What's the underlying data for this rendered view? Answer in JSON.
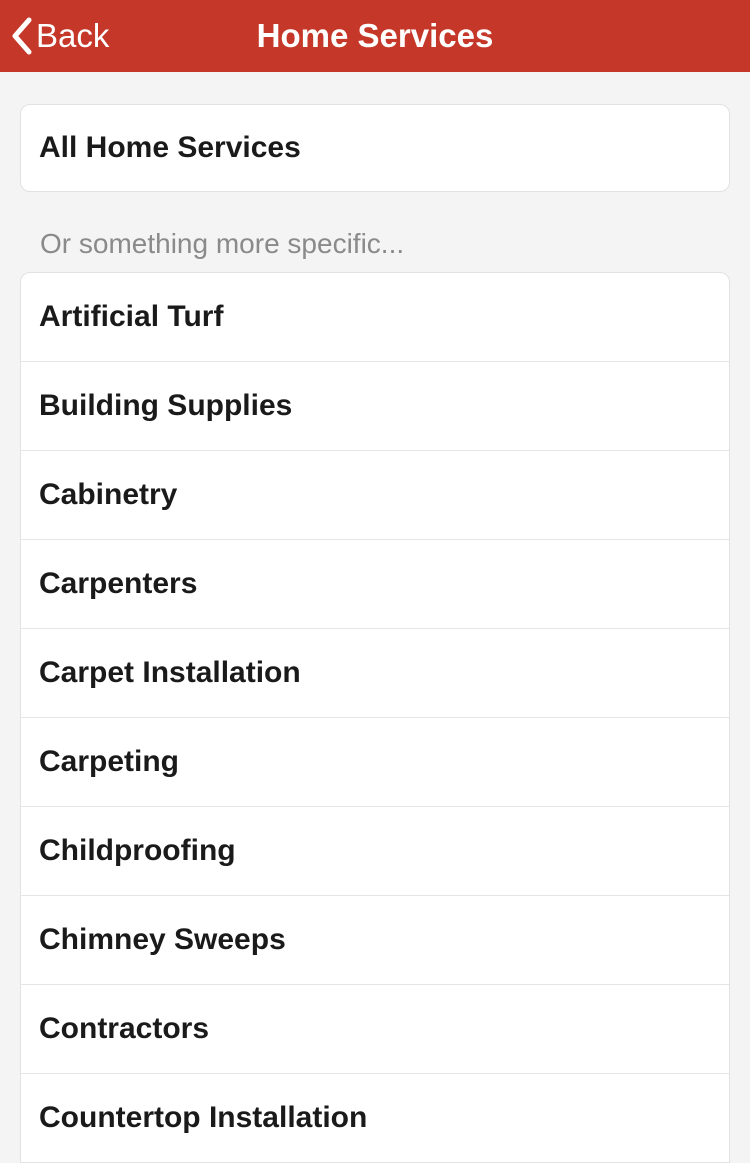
{
  "header": {
    "back_label": "Back",
    "title": "Home Services"
  },
  "all_card": {
    "label": "All Home Services"
  },
  "separator": {
    "text": "Or something more specific..."
  },
  "categories": [
    {
      "label": "Artificial Turf"
    },
    {
      "label": "Building Supplies"
    },
    {
      "label": "Cabinetry"
    },
    {
      "label": "Carpenters"
    },
    {
      "label": "Carpet Installation"
    },
    {
      "label": "Carpeting"
    },
    {
      "label": "Childproofing"
    },
    {
      "label": "Chimney Sweeps"
    },
    {
      "label": "Contractors"
    },
    {
      "label": "Countertop Installation"
    }
  ],
  "colors": {
    "header_bg": "#c53728",
    "page_bg": "#f4f4f4"
  }
}
